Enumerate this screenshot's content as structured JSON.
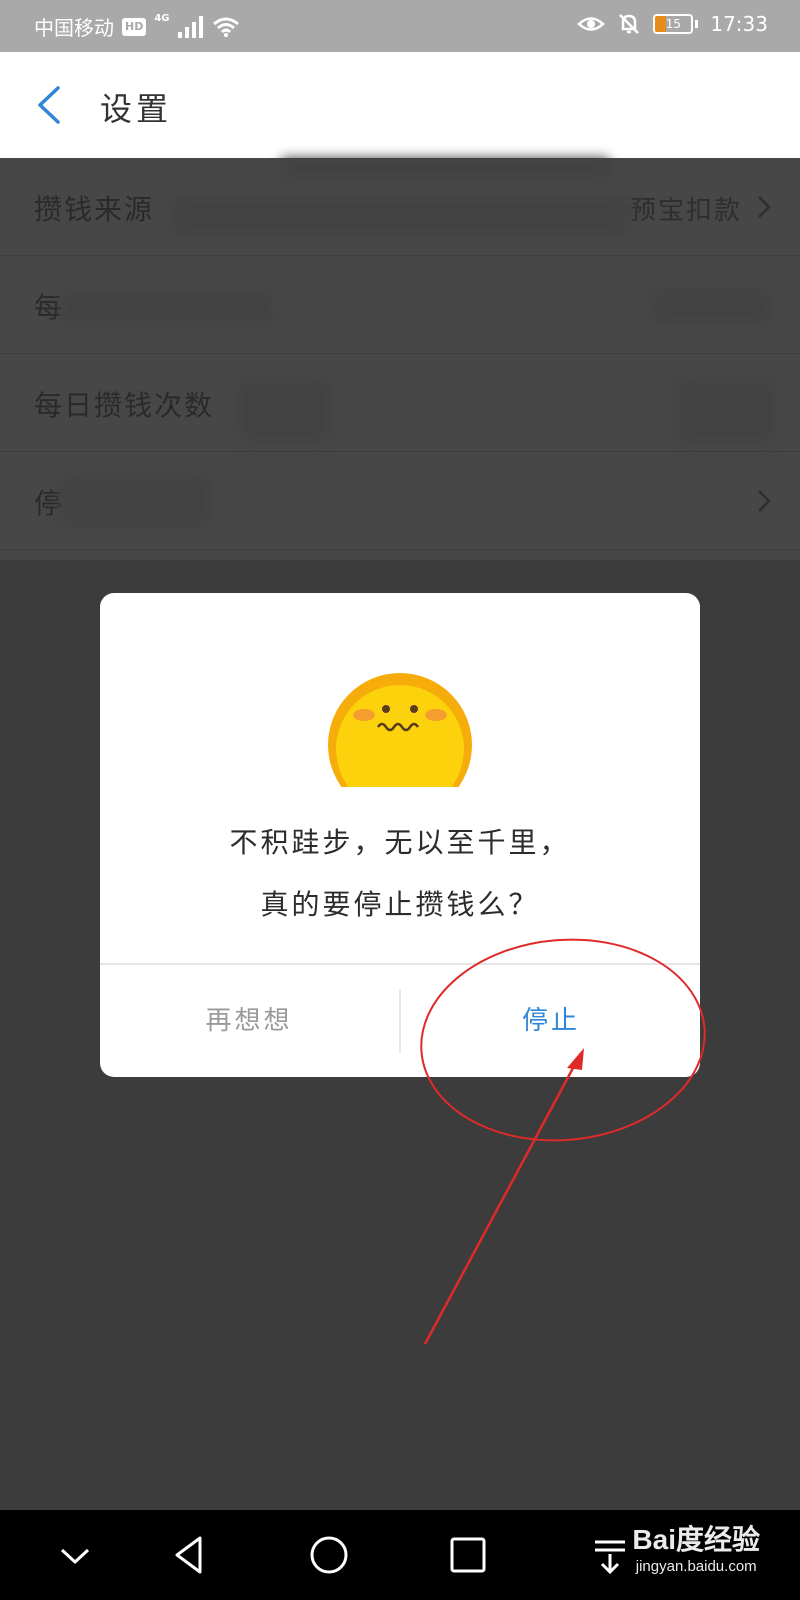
{
  "status_bar": {
    "carrier": "中国移动",
    "hd_badge": "HD",
    "network": "4G",
    "battery_level": "15",
    "time": "17:33",
    "icons": [
      "signal-icon",
      "wifi-icon",
      "eye-icon",
      "bell-off-icon",
      "battery-icon"
    ]
  },
  "header": {
    "title": "设置"
  },
  "settings": {
    "rows": [
      {
        "label": "攒钱来源",
        "value": "预宝扣款"
      },
      {
        "label": "每",
        "value": ""
      },
      {
        "label": "每日攒钱次数",
        "value": ""
      },
      {
        "label": "停",
        "value": ""
      }
    ]
  },
  "dialog": {
    "message_line1": "不积跬步，无以至千里，",
    "message_line2": "真的要停止攒钱么？",
    "cancel_label": "再想想",
    "confirm_label": "停止"
  },
  "watermark": {
    "brand": "Bai度经验",
    "url": "jingyan.baidu.com"
  },
  "colors": {
    "accent": "#2f86d6",
    "annotation": "#e02a2a",
    "emoji": "#fbd20b"
  }
}
